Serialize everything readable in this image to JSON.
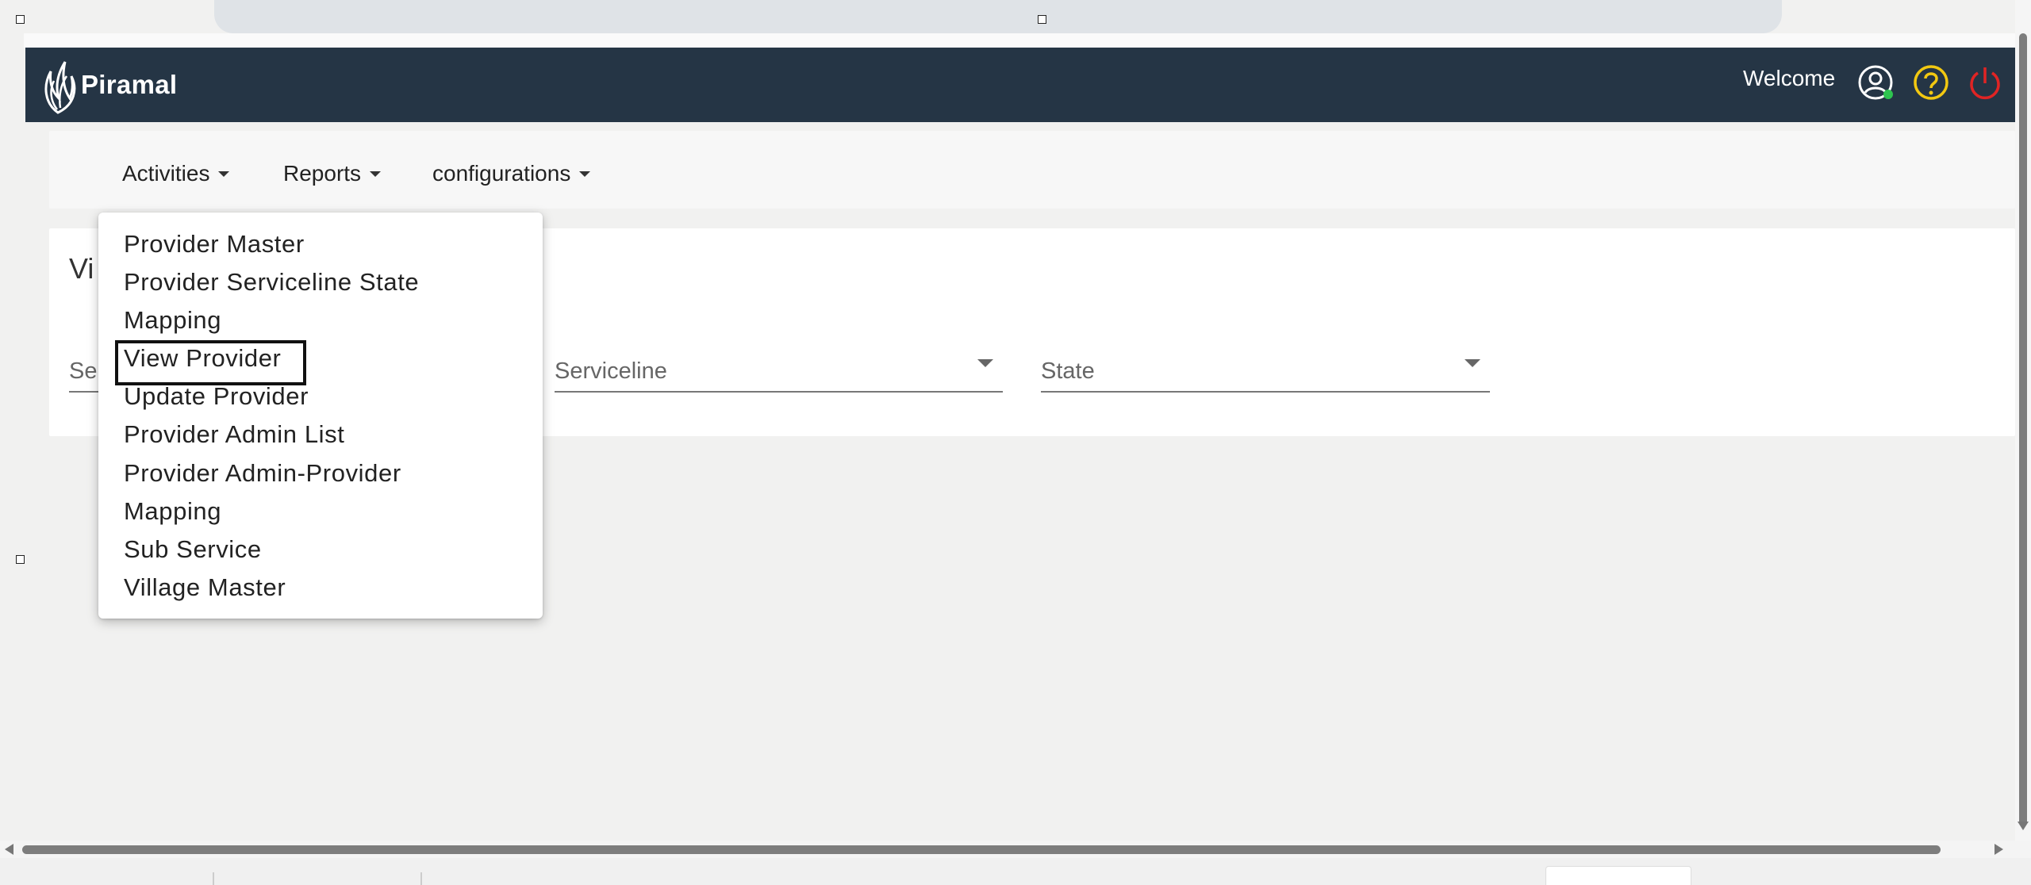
{
  "header": {
    "logo_text": "Piramal",
    "welcome": "Welcome",
    "icons": [
      "user-profile-icon",
      "help-icon",
      "power-icon"
    ],
    "colors": {
      "bar": "#253545",
      "help": "#f2c811",
      "power": "#e02424",
      "status_dot": "#2ec44f"
    }
  },
  "menubar": {
    "activities": "Activities",
    "reports": "Reports",
    "configurations": "configurations"
  },
  "card": {
    "title_partial": "Vi",
    "fields": {
      "search_partial": "Se",
      "serviceline": "Serviceline",
      "state": "State"
    }
  },
  "dropdown": {
    "items": [
      "Provider Master",
      "Provider Serviceline State",
      "Mapping",
      "View Provider",
      "Update Provider",
      "Provider Admin List",
      "Provider Admin-Provider",
      "Mapping",
      "Sub Service",
      "Village Master"
    ],
    "highlighted": "View Provider"
  }
}
